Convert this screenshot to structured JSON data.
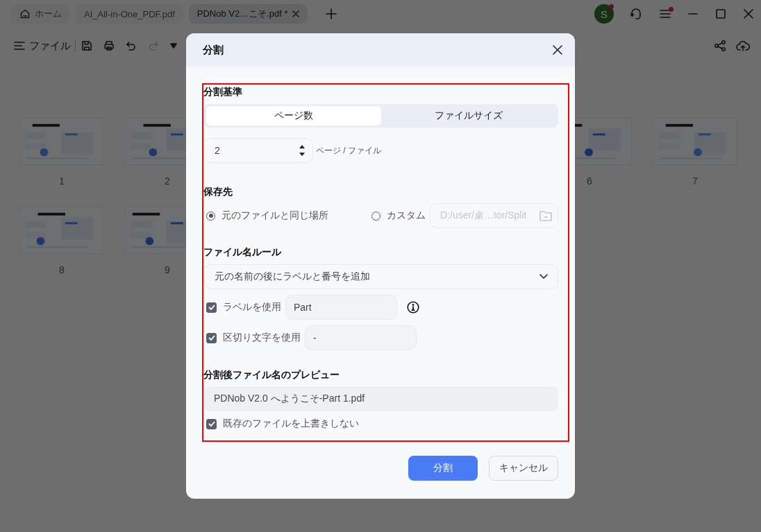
{
  "tabs": [
    {
      "kind": "home",
      "label": "ホーム",
      "selected": false
    },
    {
      "kind": "file",
      "label": "AI_All-in-One_PDF.pdf",
      "selected": false
    },
    {
      "kind": "file",
      "label": "PDNob V2…こそ.pdf *",
      "selected": true,
      "closable": true
    }
  ],
  "account": {
    "initial": "S",
    "notification": true
  },
  "menu_notification": true,
  "toolbar": {
    "file_menu": "ファイル",
    "redo_disabled": true
  },
  "page_rows": [
    {
      "left": [
        {
          "number": "1"
        },
        {
          "number": "2"
        }
      ],
      "right": [
        {
          "number": "6"
        },
        {
          "number": "7"
        }
      ]
    },
    {
      "left": [
        {
          "number": "8"
        },
        {
          "number": "9"
        }
      ]
    }
  ],
  "dialog": {
    "title": "分割",
    "split_basis": {
      "title": "分割基準",
      "options": [
        {
          "label": "ページ数",
          "selected": true
        },
        {
          "label": "ファイルサイズ",
          "selected": false
        }
      ],
      "value": "2",
      "unit": "ページ / ファイル"
    },
    "destination": {
      "title": "保存先",
      "options": [
        {
          "kind": "same",
          "label": "元のファイルと同じ場所",
          "selected": true
        },
        {
          "kind": "custom",
          "label": "カスタム",
          "selected": false,
          "path": "D:/user/桌…tor/Split"
        }
      ]
    },
    "name_rule": {
      "title": "ファイル名ルール",
      "dropdown": "元の名前の後にラベルと番号を追加",
      "options": [
        {
          "label": "ラベルを使用",
          "checked": true,
          "value": "Part",
          "info": true
        },
        {
          "label": "区切り文字を使用",
          "checked": true,
          "value": "-"
        }
      ]
    },
    "preview": {
      "title": "分割後ファイル名のプレビュー",
      "value": "PDNob V2.0 へようこそ-Part 1.pdf"
    },
    "no_overwrite": {
      "label": "既存のファイルを上書きしない",
      "checked": true
    },
    "buttons": [
      {
        "kind": "primary",
        "label": "分割"
      },
      {
        "kind": "secondary",
        "label": "キャンセル"
      }
    ]
  }
}
